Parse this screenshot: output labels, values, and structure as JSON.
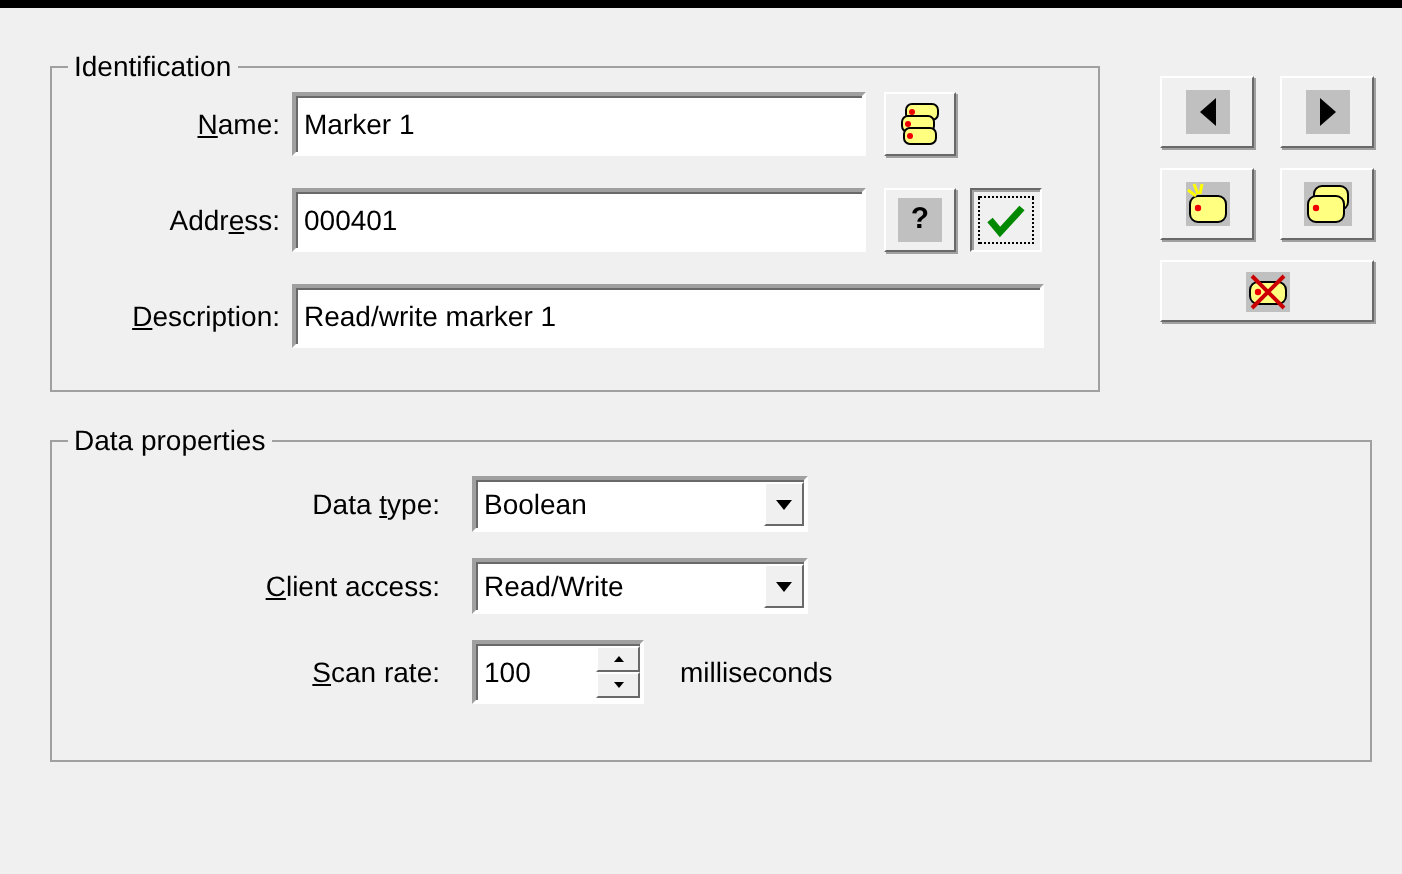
{
  "identification": {
    "title": "Identification",
    "fields": [
      {
        "label": {
          "key": "N",
          "after": "ame:"
        },
        "value": "Marker 1",
        "buttons": [
          {
            "kind": "tags",
            "focused": false
          }
        ]
      },
      {
        "label": {
          "before": "Addr",
          "key": "e",
          "after": "ss:"
        },
        "value": "000401",
        "buttons": [
          {
            "kind": "text",
            "text": "?",
            "focused": false
          },
          {
            "kind": "check",
            "focused": true
          }
        ]
      },
      {
        "label": {
          "key": "D",
          "after": "escription:"
        },
        "value": "Read/write marker 1"
      }
    ]
  },
  "record_buttons": [
    {
      "kind": "prev"
    },
    {
      "kind": "next"
    },
    {
      "kind": "new"
    },
    {
      "kind": "duplicate"
    },
    {
      "kind": "delete"
    }
  ],
  "data_properties": {
    "title": "Data properties",
    "fields": [
      {
        "kind": "select",
        "label": {
          "before": "Data ",
          "key": "t",
          "after": "ype:"
        },
        "value": "Boolean"
      },
      {
        "kind": "select",
        "label": {
          "key": "C",
          "after": "lient access:"
        },
        "value": "Read/Write"
      },
      {
        "kind": "spin",
        "label": {
          "key": "S",
          "after": "can rate:"
        },
        "value": "100",
        "unit": "milliseconds"
      }
    ]
  }
}
